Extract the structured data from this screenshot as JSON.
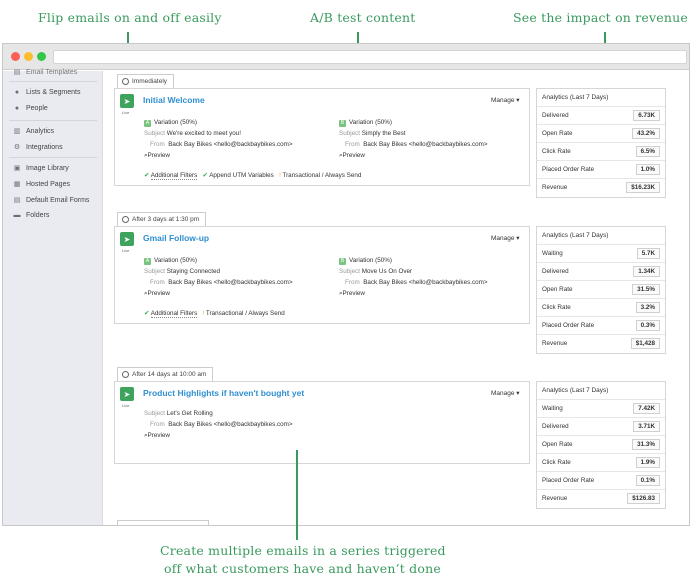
{
  "callouts": {
    "flip": "Flip emails on and off easily",
    "ab": "A/B test content",
    "impact": "See the impact on revenue",
    "series_line1": "Create multiple emails in a series triggered",
    "series_line2": "off what customers have and haven’t done"
  },
  "colors": {
    "accent_green": "#3a9a5e",
    "link_blue": "#2f8fd0",
    "warning_orange": "#e8a030"
  },
  "sidebar": {
    "items": [
      {
        "label": "Email Templates",
        "icon": "template-icon"
      },
      {
        "label": "Lists & Segments",
        "icon": "people-group-icon"
      },
      {
        "label": "People",
        "icon": "person-icon"
      },
      {
        "label": "Analytics",
        "icon": "bar-chart-icon"
      },
      {
        "label": "Integrations",
        "icon": "integrations-icon"
      },
      {
        "label": "Image Library",
        "icon": "image-icon"
      },
      {
        "label": "Hosted Pages",
        "icon": "building-icon"
      },
      {
        "label": "Default Email Forms",
        "icon": "form-icon"
      },
      {
        "label": "Folders",
        "icon": "folder-icon"
      }
    ]
  },
  "emails": [
    {
      "trigger": "Immediately",
      "title": "Initial Welcome",
      "status": "Live",
      "manage": "Manage ▾",
      "variations": [
        {
          "badge": "A",
          "label": "Variation (50%)",
          "subject": "We're excited to meet you!",
          "from": "Back Bay Bikes <hello@backbaybikes.com>",
          "preview": "Preview"
        },
        {
          "badge": "B",
          "label": "Variation (50%)",
          "subject": "Simply the Best",
          "from": "Back Bay Bikes <hello@backbaybikes.com>",
          "preview": "Preview"
        }
      ],
      "footer": [
        "Additional Filters",
        "Append UTM Variables",
        "Transactional / Always Send"
      ],
      "analytics": {
        "title": "Analytics (Last 7 Days)",
        "rows": [
          {
            "label": "Delivered",
            "value": "6.73K"
          },
          {
            "label": "Open Rate",
            "value": "43.2%"
          },
          {
            "label": "Click Rate",
            "value": "6.5%"
          },
          {
            "label": "Placed Order Rate",
            "value": "1.0%"
          },
          {
            "label": "Revenue",
            "value": "$16.23K"
          }
        ]
      }
    },
    {
      "trigger": "After 3 days at 1:30 pm",
      "title": "Gmail Follow-up",
      "status": "Live",
      "manage": "Manage ▾",
      "variations": [
        {
          "badge": "A",
          "label": "Variation (50%)",
          "subject": "Staying Connected",
          "from": "Back Bay Bikes <hello@backbaybikes.com>",
          "preview": "Preview"
        },
        {
          "badge": "B",
          "label": "Variation (50%)",
          "subject": "Move Us On Over",
          "from": "Back Bay Bikes <hello@backbaybikes.com>",
          "preview": "Preview"
        }
      ],
      "footer": [
        "Additional Filters",
        "Transactional / Always Send"
      ],
      "analytics": {
        "title": "Analytics (Last 7 Days)",
        "rows": [
          {
            "label": "Waiting",
            "value": "5.7K"
          },
          {
            "label": "Delivered",
            "value": "1.34K"
          },
          {
            "label": "Open Rate",
            "value": "31.5%"
          },
          {
            "label": "Click Rate",
            "value": "3.2%"
          },
          {
            "label": "Placed Order Rate",
            "value": "0.3%"
          },
          {
            "label": "Revenue",
            "value": "$1,428"
          }
        ]
      }
    },
    {
      "trigger": "After 14 days at 10:00 am",
      "title": "Product Highlights if haven't bought yet",
      "status": "Live",
      "manage": "Manage ▾",
      "single": {
        "subject": "Let's Get Rolling",
        "from": "Back Bay Bikes <hello@backbaybikes.com>",
        "preview": "Preview"
      },
      "analytics": {
        "title": "Analytics (Last 7 Days)",
        "rows": [
          {
            "label": "Waiting",
            "value": "7.42K"
          },
          {
            "label": "Delivered",
            "value": "3.71K"
          },
          {
            "label": "Open Rate",
            "value": "31.3%"
          },
          {
            "label": "Click Rate",
            "value": "1.9%"
          },
          {
            "label": "Placed Order Rate",
            "value": "0.1%"
          },
          {
            "label": "Revenue",
            "value": "$126.83"
          }
        ]
      }
    }
  ],
  "labels": {
    "subject": "Subject",
    "from": "From"
  }
}
